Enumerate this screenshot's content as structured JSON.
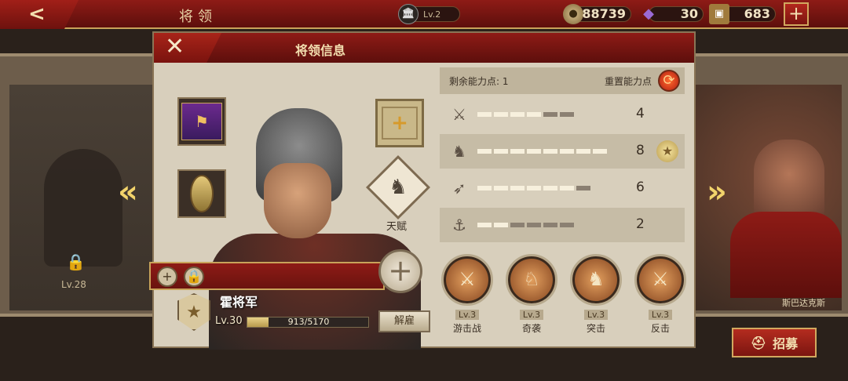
{
  "topbar": {
    "back_icon": "<",
    "title": "将领",
    "level": "Lv.2",
    "gold": "88739",
    "gems": "30",
    "tickets": "683",
    "add_icon": "+"
  },
  "left_card": {
    "level": "Lv.28"
  },
  "right_card": {
    "name": "斯巴达克斯"
  },
  "recruit": {
    "label": "招募"
  },
  "dialog": {
    "title": "将领信息",
    "close_icon": "✕",
    "talent_label": "天赋",
    "general": {
      "name": "霍将军",
      "level": "Lv.30",
      "xp_text": "913/5170",
      "xp_current": 913,
      "xp_max": 5170,
      "dismiss_label": "解雇"
    },
    "stats": {
      "points_label": "剩余能力点: 1",
      "reset_label": "重置能力点",
      "rows": [
        {
          "icon": "sword-icon",
          "glyph": "⚔",
          "value": 4,
          "filled": 4,
          "total": 6
        },
        {
          "icon": "horse-icon",
          "glyph": "♞",
          "value": 8,
          "filled": 8,
          "total": 8
        },
        {
          "icon": "bow-icon",
          "glyph": "➶",
          "value": 6,
          "filled": 6,
          "total": 7
        },
        {
          "icon": "anchor-icon",
          "glyph": "⚓",
          "value": 2,
          "filled": 2,
          "total": 6
        }
      ]
    },
    "skills": [
      {
        "level": "Lv.3",
        "name": "游击战"
      },
      {
        "level": "Lv.3",
        "name": "奇袭"
      },
      {
        "level": "Lv.3",
        "name": "突击"
      },
      {
        "level": "Lv.3",
        "name": "反击"
      }
    ]
  }
}
